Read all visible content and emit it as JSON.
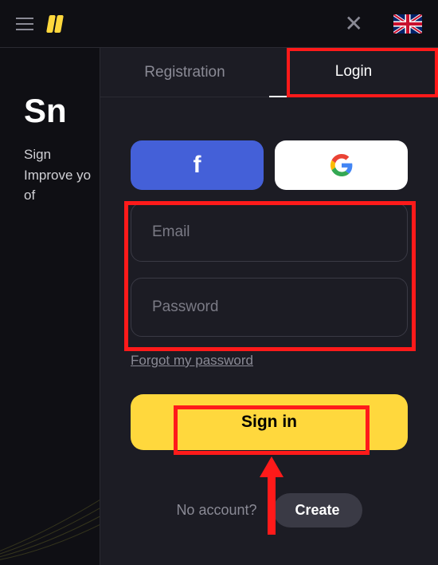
{
  "header": {
    "menu_label": "menu",
    "close_label": "close",
    "language": "UK"
  },
  "background": {
    "title": "Sn",
    "line1": "Sign",
    "line2": "Improve yo",
    "line3": "of"
  },
  "tabs": {
    "registration": "Registration",
    "login": "Login"
  },
  "social": {
    "facebook": "f",
    "google": "G"
  },
  "form": {
    "email_placeholder": "Email",
    "password_placeholder": "Password",
    "forgot": "Forgot my password",
    "signin": "Sign in"
  },
  "footer": {
    "no_account": "No account?",
    "create": "Create"
  },
  "colors": {
    "accent": "#ffd83d",
    "highlight": "#ff1a1a",
    "facebook": "#4460d8",
    "panel": "#1c1c24",
    "bg": "#0f0f14"
  }
}
